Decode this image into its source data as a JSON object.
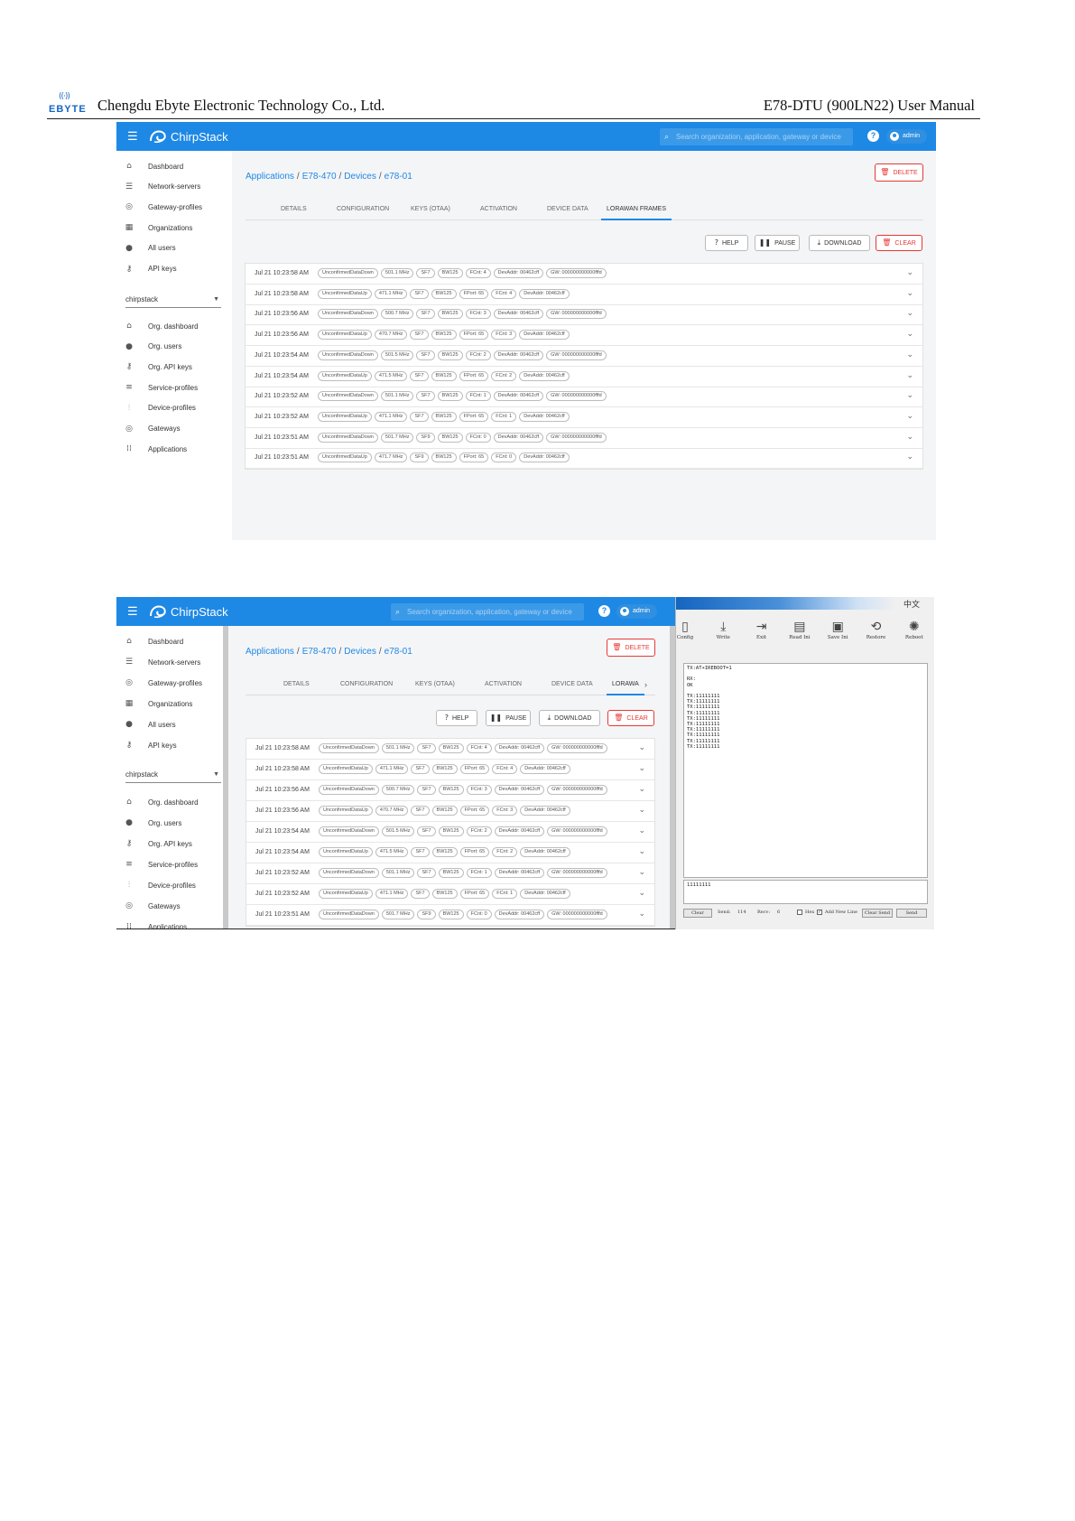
{
  "doc_header": {
    "logo_text": "EBYTE",
    "company": "Chengdu Ebyte Electronic Technology Co., Ltd.",
    "manual_title": "E78-DTU (900LN22) User Manual"
  },
  "app": {
    "brand": "ChirpStack",
    "search_placeholder": "Search organization, application, gateway or device",
    "help": "?",
    "user": "admin"
  },
  "sidebar": {
    "items_top": [
      {
        "label": "Dashboard",
        "icon": "home-icon"
      },
      {
        "label": "Network-servers",
        "icon": "server-icon"
      },
      {
        "label": "Gateway-profiles",
        "icon": "wifi-icon"
      },
      {
        "label": "Organizations",
        "icon": "building-icon"
      },
      {
        "label": "All users",
        "icon": "user-icon"
      },
      {
        "label": "API keys",
        "icon": "key-icon"
      }
    ],
    "org_select": "chirpstack",
    "items_org": [
      {
        "label": "Org. dashboard",
        "icon": "home-icon"
      },
      {
        "label": "Org. users",
        "icon": "user-icon"
      },
      {
        "label": "Org. API keys",
        "icon": "key-icon"
      },
      {
        "label": "Service-profiles",
        "icon": "list-icon"
      },
      {
        "label": "Device-profiles",
        "icon": "sliders-icon"
      },
      {
        "label": "Gateways",
        "icon": "wifi-icon"
      },
      {
        "label": "Applications",
        "icon": "apps-icon"
      }
    ]
  },
  "breadcrumb": [
    "Applications",
    "E78-470",
    "Devices",
    "e78-01"
  ],
  "buttons": {
    "delete": "DELETE",
    "help": "HELP",
    "pause": "PAUSE",
    "download": "DOWNLOAD",
    "clear": "CLEAR"
  },
  "tabs": [
    "DETAILS",
    "CONFIGURATION",
    "KEYS (OTAA)",
    "ACTIVATION",
    "DEVICE DATA",
    "LORAWAN FRAMES"
  ],
  "tabs_truncated_label": "LORAWA",
  "frames": [
    {
      "time": "Jul 21 10:23:58 AM",
      "chips": [
        "UnconfirmedDataDown",
        "501.1 MHz",
        "SF7",
        "BW125",
        "FCnt: 4",
        "DevAddr: 00462cff",
        "GW: 000000000000fffd"
      ]
    },
    {
      "time": "Jul 21 10:23:58 AM",
      "chips": [
        "UnconfirmedDataUp",
        "471.1 MHz",
        "SF7",
        "BW125",
        "FPort: 65",
        "FCnt: 4",
        "DevAddr: 00462cff"
      ]
    },
    {
      "time": "Jul 21 10:23:56 AM",
      "chips": [
        "UnconfirmedDataDown",
        "500.7 MHz",
        "SF7",
        "BW125",
        "FCnt: 3",
        "DevAddr: 00462cff",
        "GW: 000000000000fffd"
      ]
    },
    {
      "time": "Jul 21 10:23:56 AM",
      "chips": [
        "UnconfirmedDataUp",
        "470.7 MHz",
        "SF7",
        "BW125",
        "FPort: 65",
        "FCnt: 3",
        "DevAddr: 00462cff"
      ]
    },
    {
      "time": "Jul 21 10:23:54 AM",
      "chips": [
        "UnconfirmedDataDown",
        "501.5 MHz",
        "SF7",
        "BW125",
        "FCnt: 2",
        "DevAddr: 00462cff",
        "GW: 000000000000fffd"
      ]
    },
    {
      "time": "Jul 21 10:23:54 AM",
      "chips": [
        "UnconfirmedDataUp",
        "471.5 MHz",
        "SF7",
        "BW125",
        "FPort: 65",
        "FCnt: 2",
        "DevAddr: 00462cff"
      ]
    },
    {
      "time": "Jul 21 10:23:52 AM",
      "chips": [
        "UnconfirmedDataDown",
        "501.1 MHz",
        "SF7",
        "BW125",
        "FCnt: 1",
        "DevAddr: 00462cff",
        "GW: 000000000000fffd"
      ]
    },
    {
      "time": "Jul 21 10:23:52 AM",
      "chips": [
        "UnconfirmedDataUp",
        "471.1 MHz",
        "SF7",
        "BW125",
        "FPort: 65",
        "FCnt: 1",
        "DevAddr: 00462cff"
      ]
    },
    {
      "time": "Jul 21 10:23:51 AM",
      "chips": [
        "UnconfirmedDataDown",
        "501.7 MHz",
        "SF9",
        "BW125",
        "FCnt: 0",
        "DevAddr: 00462cff",
        "GW: 000000000000fffd"
      ]
    },
    {
      "time": "Jul 21 10:23:51 AM",
      "chips": [
        "UnconfirmedDataUp",
        "471.7 MHz",
        "SF9",
        "BW125",
        "FPort: 65",
        "FCnt: 0",
        "DevAddr: 00462cff"
      ]
    }
  ],
  "terminal": {
    "lang": "中文",
    "toolbar": [
      {
        "label": "Config",
        "icon": "config-icon"
      },
      {
        "label": "Write",
        "icon": "download-icon"
      },
      {
        "label": "Exit",
        "icon": "exit-icon"
      },
      {
        "label": "Read Ini",
        "icon": "read-file-icon"
      },
      {
        "label": "Save Ini",
        "icon": "save-file-icon"
      },
      {
        "label": "Restore",
        "icon": "restore-icon"
      },
      {
        "label": "Reboot",
        "icon": "reboot-icon"
      }
    ],
    "output": [
      "TX:AT+IREBOOT=1",
      "RX:",
      "OK",
      "TX:11111111",
      "TX:11111111",
      "TX:11111111",
      "TX:11111111",
      "TX:11111111",
      "TX:11111111",
      "TX:11111111",
      "TX:11111111",
      "TX:11111111",
      "TX:11111111"
    ],
    "input": "11111111",
    "footer": {
      "clear": "Clear",
      "send_label": "Send:",
      "send_count": "114",
      "recv_label": "Recv:",
      "recv_count": "6",
      "hex": "Hex",
      "add_new_line": "Add New Line",
      "clear_send": "Clear Send",
      "send": "Send"
    }
  }
}
